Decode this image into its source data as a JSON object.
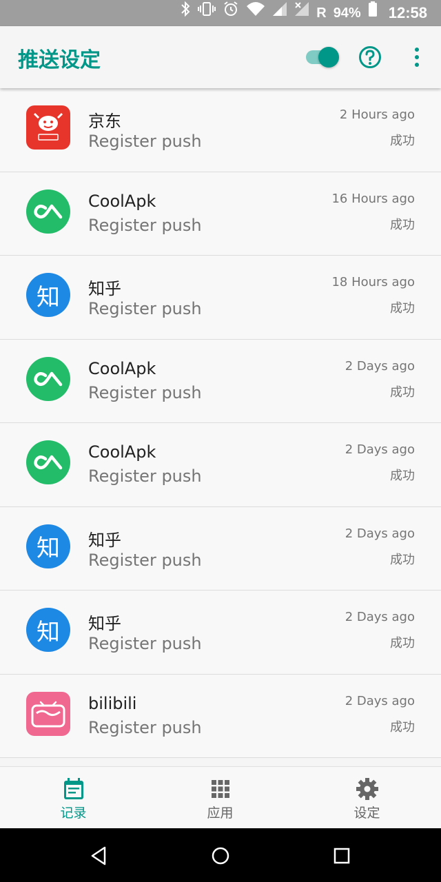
{
  "status_bar": {
    "signal_letter": "R",
    "battery": "94%",
    "time": "12:58"
  },
  "app_bar": {
    "title": "推送设定",
    "toggle_on": true
  },
  "records": [
    {
      "app": "京东",
      "action": "Register push",
      "time": "2 Hours ago",
      "status": "成功",
      "icon": "jd-icon"
    },
    {
      "app": "CoolApk",
      "action": "Register push",
      "time": "16 Hours ago",
      "status": "成功",
      "icon": "coolapk-icon"
    },
    {
      "app": "知乎",
      "action": "Register push",
      "time": "18 Hours ago",
      "status": "成功",
      "icon": "zhihu-icon",
      "icon_text": "知"
    },
    {
      "app": "CoolApk",
      "action": "Register push",
      "time": "2 Days ago",
      "status": "成功",
      "icon": "coolapk-icon"
    },
    {
      "app": "CoolApk",
      "action": "Register push",
      "time": "2 Days ago",
      "status": "成功",
      "icon": "coolapk-icon"
    },
    {
      "app": "知乎",
      "action": "Register push",
      "time": "2 Days ago",
      "status": "成功",
      "icon": "zhihu-icon",
      "icon_text": "知"
    },
    {
      "app": "知乎",
      "action": "Register push",
      "time": "2 Days ago",
      "status": "成功",
      "icon": "zhihu-icon",
      "icon_text": "知"
    },
    {
      "app": "bilibili",
      "action": "Register push",
      "time": "2 Days ago",
      "status": "成功",
      "icon": "bilibili-icon"
    }
  ],
  "bottom_nav": {
    "records": "记录",
    "apps": "应用",
    "settings": "设定"
  },
  "colors": {
    "accent": "#009688",
    "coolapk": "#23bd6a",
    "zhihu": "#1e88e5",
    "jd": "#e8352b",
    "bilibili": "#f06790"
  }
}
